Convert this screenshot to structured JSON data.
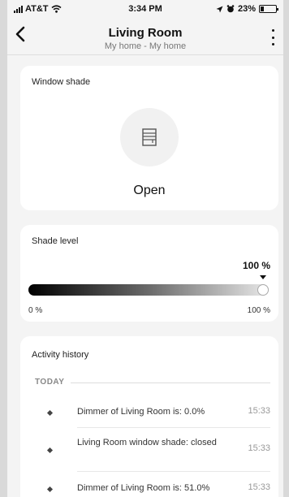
{
  "status_bar": {
    "carrier": "AT&T",
    "time": "3:34 PM",
    "battery": "23%",
    "battery_level": 0.23
  },
  "header": {
    "title": "Living Room",
    "subtitle": "My home - My home"
  },
  "window_shade": {
    "title": "Window shade",
    "state": "Open"
  },
  "shade_level": {
    "title": "Shade level",
    "value_label": "100 %",
    "value": 100,
    "min_label": "0 %",
    "max_label": "100 %"
  },
  "activity": {
    "title": "Activity history",
    "group_label": "TODAY",
    "items": [
      {
        "text": "Dimmer of Living Room is: 0.0%",
        "time": "15:33"
      },
      {
        "text": "Living Room window shade: closed",
        "time": "15:33"
      },
      {
        "text": "Dimmer of Living Room is: 51.0%",
        "time": "15:33"
      }
    ]
  }
}
